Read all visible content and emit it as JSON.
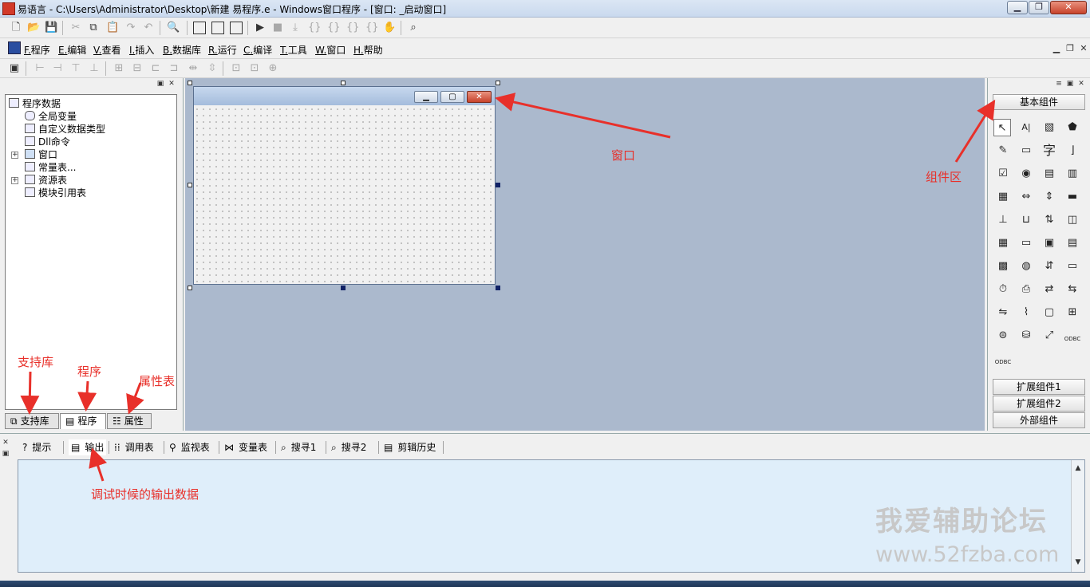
{
  "titlebar": {
    "title": "易语言 - C:\\Users\\Administrator\\Desktop\\新建 易程序.e - Windows窗口程序 - [窗口: _启动窗口]"
  },
  "menu": {
    "items": [
      {
        "key": "F.",
        "label": "程序"
      },
      {
        "key": "E.",
        "label": "编辑"
      },
      {
        "key": "V.",
        "label": "查看"
      },
      {
        "key": "I.",
        "label": "插入"
      },
      {
        "key": "B.",
        "label": "数据库"
      },
      {
        "key": "R.",
        "label": "运行"
      },
      {
        "key": "C.",
        "label": "编译"
      },
      {
        "key": "T.",
        "label": "工具"
      },
      {
        "key": "W.",
        "label": "窗口"
      },
      {
        "key": "H.",
        "label": "帮助"
      }
    ]
  },
  "tree": {
    "items": [
      {
        "label": "程序数据"
      },
      {
        "label": "全局变量"
      },
      {
        "label": "自定义数据类型"
      },
      {
        "label": "Dll命令"
      },
      {
        "label": "窗口"
      },
      {
        "label": "常量表..."
      },
      {
        "label": "资源表"
      },
      {
        "label": "模块引用表"
      }
    ]
  },
  "left_tabs": [
    {
      "label": "支持库"
    },
    {
      "label": "程序"
    },
    {
      "label": "属性"
    }
  ],
  "components": {
    "categories": {
      "basic": "基本组件",
      "ext1": "扩展组件1",
      "ext2": "扩展组件2",
      "external": "外部组件"
    },
    "label_icon_text": "A|",
    "static_text_icon": "字",
    "odbc": "ODBC"
  },
  "bottom_tabs": [
    {
      "label": "提示"
    },
    {
      "label": "输出"
    },
    {
      "label": "调用表"
    },
    {
      "label": "监视表"
    },
    {
      "label": "变量表"
    },
    {
      "label": "搜寻1"
    },
    {
      "label": "搜寻2"
    },
    {
      "label": "剪辑历史"
    }
  ],
  "annotations": {
    "window": "窗口",
    "components_area": "组件区",
    "support_lib": "支持库",
    "program": "程序",
    "property_table": "属性表",
    "output_desc": "调试时候的输出数据",
    "color": "#e8302a"
  },
  "watermark": {
    "line1": "我爱辅助论坛",
    "line2": "www.52fzba.com"
  }
}
